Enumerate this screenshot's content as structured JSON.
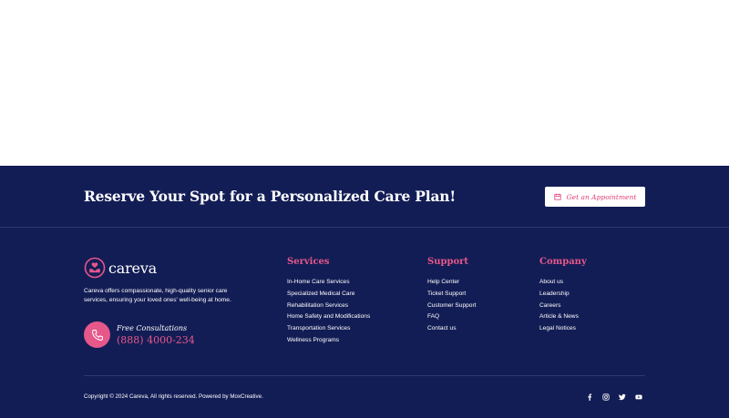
{
  "cta": {
    "title": "Reserve Your Spot for a Personalized Care Plan!",
    "button_label": "Get an Appointment"
  },
  "brand": {
    "name": "careva",
    "description": "Careva offers compassionate, high-quality senior care services, ensuring your loved ones' well-being at home.",
    "consult_label": "Free Consultations",
    "consult_phone": "(888) 4000-234"
  },
  "columns": {
    "services": {
      "title": "Services",
      "items": [
        "In-Home Care Services",
        "Specialized Medical Care",
        "Rehabilitation Services",
        "Home Safety and Modifications",
        "Transportation Services",
        "Wellness Programs"
      ]
    },
    "support": {
      "title": "Support",
      "items": [
        "Help Center",
        "Ticket Support",
        "Customer Support",
        "FAQ",
        "Contact us"
      ]
    },
    "company": {
      "title": "Company",
      "items": [
        "About us",
        "Leadership",
        "Careers",
        "Article & News",
        "Legal Notices"
      ]
    }
  },
  "bottom": {
    "copyright": "Copyright © 2024 Careva, All rights reserved. Powered by MoxCreative.",
    "socials": [
      "facebook-icon",
      "instagram-icon",
      "twitter-icon",
      "youtube-icon"
    ]
  },
  "colors": {
    "footer_bg": "#131d55",
    "accent": "#e6578a"
  }
}
